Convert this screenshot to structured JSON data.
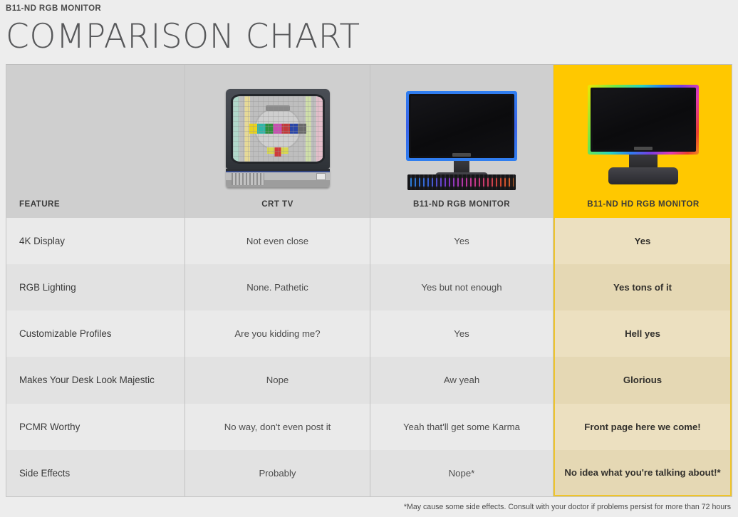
{
  "header": {
    "kicker": "B11-ND RGB MONITOR",
    "title": "COMPARISON CHART"
  },
  "colors": {
    "page_background": "#ededed",
    "header_row": "#cfcfcf",
    "highlight_header": "#ffc800",
    "highlight_body_light": "#ece0c0",
    "highlight_body_dark": "#e5d8b4",
    "highlight_border": "#f0c52a",
    "row_light": "#eaeaea",
    "row_dark": "#e2e2e2",
    "text": "#3c3c3c"
  },
  "chart_data": {
    "type": "table",
    "title": "COMPARISON CHART",
    "columns": [
      {
        "label": "FEATURE",
        "image": null,
        "highlighted": false
      },
      {
        "label": "CRT TV",
        "image": "crt-tv-illustration",
        "highlighted": false
      },
      {
        "label": "B11-ND RGB MONITOR",
        "image": "rgb-monitor-with-keyboard-illustration",
        "highlighted": false
      },
      {
        "label": "B11-ND HD RGB MONITOR",
        "image": "hd-rgb-monitor-illustration",
        "highlighted": true
      }
    ],
    "rows": [
      {
        "feature": "4K Display",
        "crt": "Not even close",
        "rgb": "Yes",
        "hd": "Yes"
      },
      {
        "feature": "RGB Lighting",
        "crt": "None. Pathetic",
        "rgb": "Yes but not enough",
        "hd": "Yes tons of it"
      },
      {
        "feature": "Customizable Profiles",
        "crt": "Are you kidding me?",
        "rgb": "Yes",
        "hd": "Hell yes"
      },
      {
        "feature": "Makes Your Desk Look Majestic",
        "crt": "Nope",
        "rgb": "Aw yeah",
        "hd": "Glorious"
      },
      {
        "feature": "PCMR Worthy",
        "crt": "No way, don't even post it",
        "rgb": "Yeah that'll get some Karma",
        "hd": "Front page here we come!"
      },
      {
        "feature": "Side Effects",
        "crt": "Probably",
        "rgb": "Nope*",
        "hd": "No idea what you're talking about!*"
      }
    ]
  },
  "footnote": "*May cause some side effects. Consult with your doctor if problems persist for more than 72 hours"
}
